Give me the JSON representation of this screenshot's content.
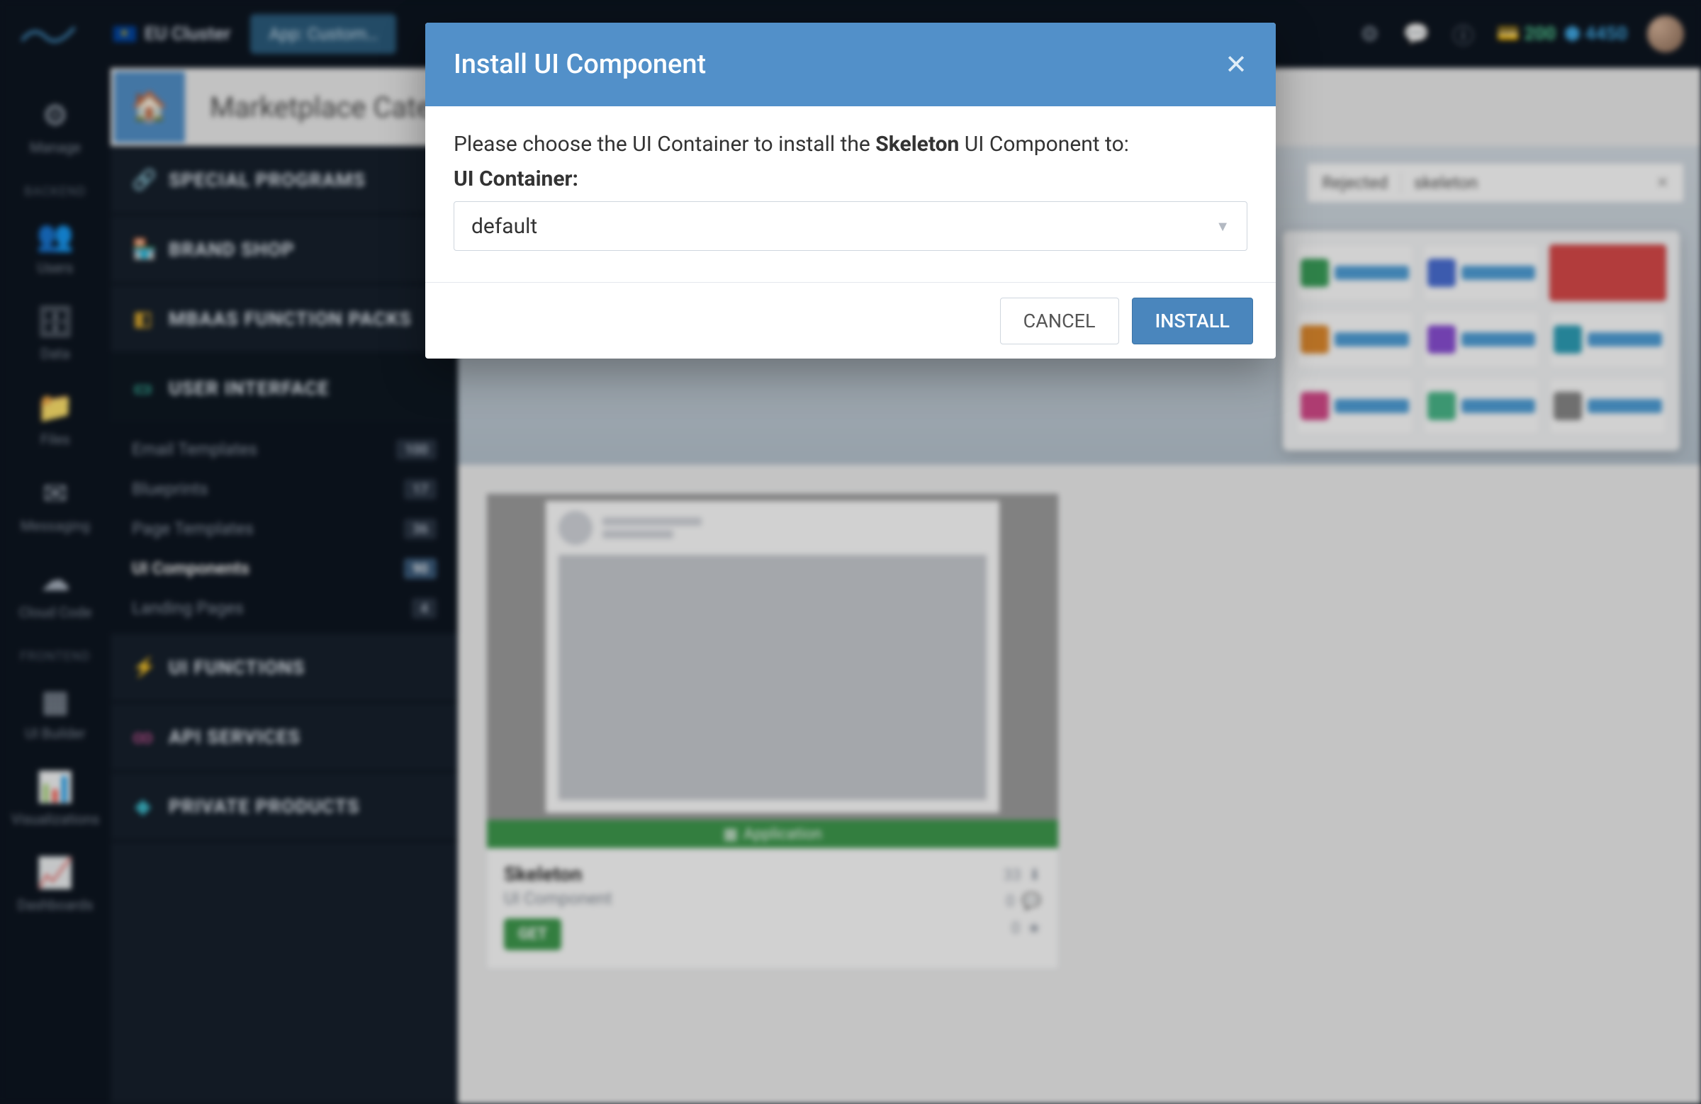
{
  "topbar": {
    "cluster": "EU Cluster",
    "app_tab": "App: Custom…",
    "credits_green": "200",
    "credits_blue": "4450"
  },
  "rail": {
    "sections": [
      {
        "label": "Manage",
        "icon": "⚙"
      }
    ],
    "backend_header": "BACKEND",
    "backend": [
      {
        "label": "Users",
        "icon": "👥"
      },
      {
        "label": "Data",
        "icon": "🗄"
      },
      {
        "label": "Files",
        "icon": "📁"
      },
      {
        "label": "Messaging",
        "icon": "✉"
      },
      {
        "label": "Cloud Code",
        "icon": "☁"
      }
    ],
    "frontend_header": "FRONTEND",
    "frontend": [
      {
        "label": "UI Builder",
        "icon": "▦"
      },
      {
        "label": "Visualizations",
        "icon": "📊"
      },
      {
        "label": "Dashboards",
        "icon": "📈"
      }
    ]
  },
  "page": {
    "title": "Marketplace Cate…"
  },
  "sidebar": {
    "groups": [
      {
        "label": "SPECIAL PROGRAMS",
        "icon": "🔗",
        "cls": "gi-orange"
      },
      {
        "label": "BRAND SHOP",
        "icon": "🏪",
        "cls": "gi-green"
      },
      {
        "label": "MBAAS FUNCTION PACKS",
        "icon": "◧",
        "cls": "gi-yel"
      },
      {
        "label": "USER INTERFACE",
        "icon": "▭",
        "cls": "gi-teal",
        "expanded": true,
        "items": [
          {
            "label": "Email Templates",
            "badge": "100"
          },
          {
            "label": "Blueprints",
            "badge": "17"
          },
          {
            "label": "Page Templates",
            "badge": "36"
          },
          {
            "label": "UI Components",
            "badge": "90",
            "active": true
          },
          {
            "label": "Landing Pages",
            "badge": "4"
          }
        ]
      },
      {
        "label": "UI FUNCTIONS",
        "icon": "⚡",
        "cls": "gi-blue"
      },
      {
        "label": "API SERVICES",
        "icon": "∞",
        "cls": "gi-pink"
      },
      {
        "label": "PRIVATE PRODUCTS",
        "icon": "◆",
        "cls": "gi-cyan"
      }
    ]
  },
  "filters": {
    "rejected": "Rejected",
    "search": "skeleton"
  },
  "card": {
    "band": "Application",
    "title": "Skeleton",
    "subtitle": "UI Component",
    "get": "GET",
    "stats": {
      "downloads": "33",
      "comments": "0",
      "stars": "0"
    }
  },
  "modal": {
    "title": "Install UI Component",
    "lead_pre": "Please choose the UI Container to install the ",
    "lead_bold": "Skeleton",
    "lead_post": " UI Component to:",
    "field_label": "UI Container:",
    "selected": "default",
    "cancel": "CANCEL",
    "install": "INSTALL"
  }
}
